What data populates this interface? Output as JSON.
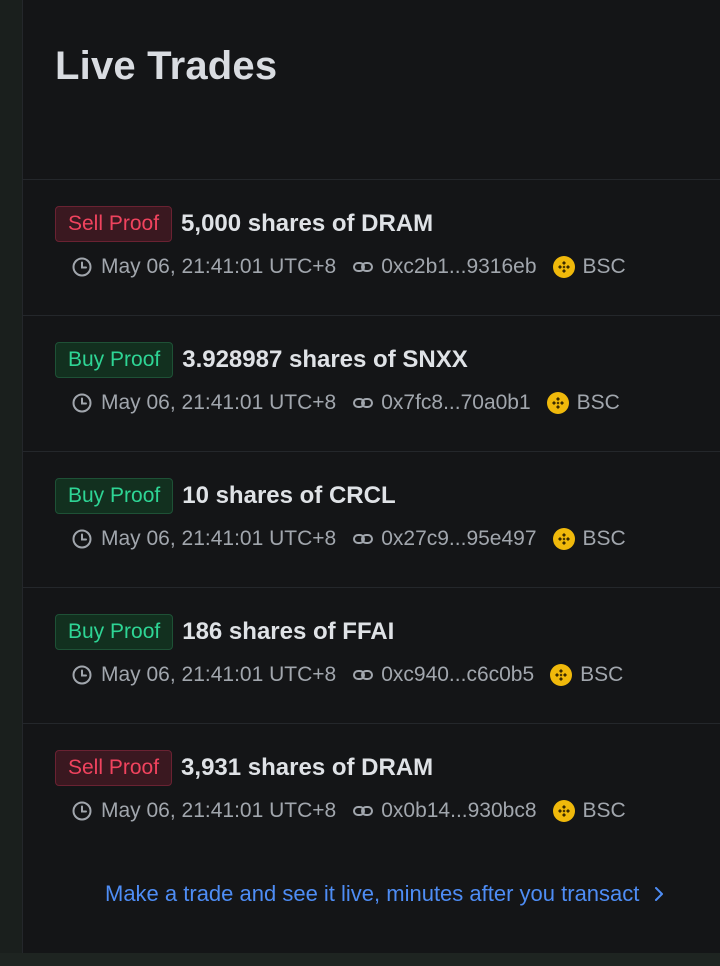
{
  "header": {
    "title": "Live Trades"
  },
  "trades": [
    {
      "badge": "Sell Proof",
      "side": "sell",
      "title": "5,000 shares of DRAM",
      "time": "May 06, 21:41:01 UTC+8",
      "tx": "0xc2b1...9316eb",
      "chain": "BSC"
    },
    {
      "badge": "Buy Proof",
      "side": "buy",
      "title": "3.928987 shares of SNXX",
      "time": "May 06, 21:41:01 UTC+8",
      "tx": "0x7fc8...70a0b1",
      "chain": "BSC"
    },
    {
      "badge": "Buy Proof",
      "side": "buy",
      "title": "10 shares of CRCL",
      "time": "May 06, 21:41:01 UTC+8",
      "tx": "0x27c9...95e497",
      "chain": "BSC"
    },
    {
      "badge": "Buy Proof",
      "side": "buy",
      "title": "186 shares of FFAI",
      "time": "May 06, 21:41:01 UTC+8",
      "tx": "0xc940...c6c0b5",
      "chain": "BSC"
    },
    {
      "badge": "Sell Proof",
      "side": "sell",
      "title": "3,931 shares of DRAM",
      "time": "May 06, 21:41:01 UTC+8",
      "tx": "0x0b14...930bc8",
      "chain": "BSC"
    }
  ],
  "footer": {
    "cta": "Make a trade and see it live, minutes after you transact"
  },
  "icons": {
    "time": "clock-icon",
    "tx": "link-icon",
    "chain": "bnb-chain-icon",
    "cta": "chevron-right-icon"
  },
  "colors": {
    "sell": "#f0435e",
    "buy": "#2ed595",
    "link": "#4e8df5",
    "bnb": "#f0b90b"
  }
}
